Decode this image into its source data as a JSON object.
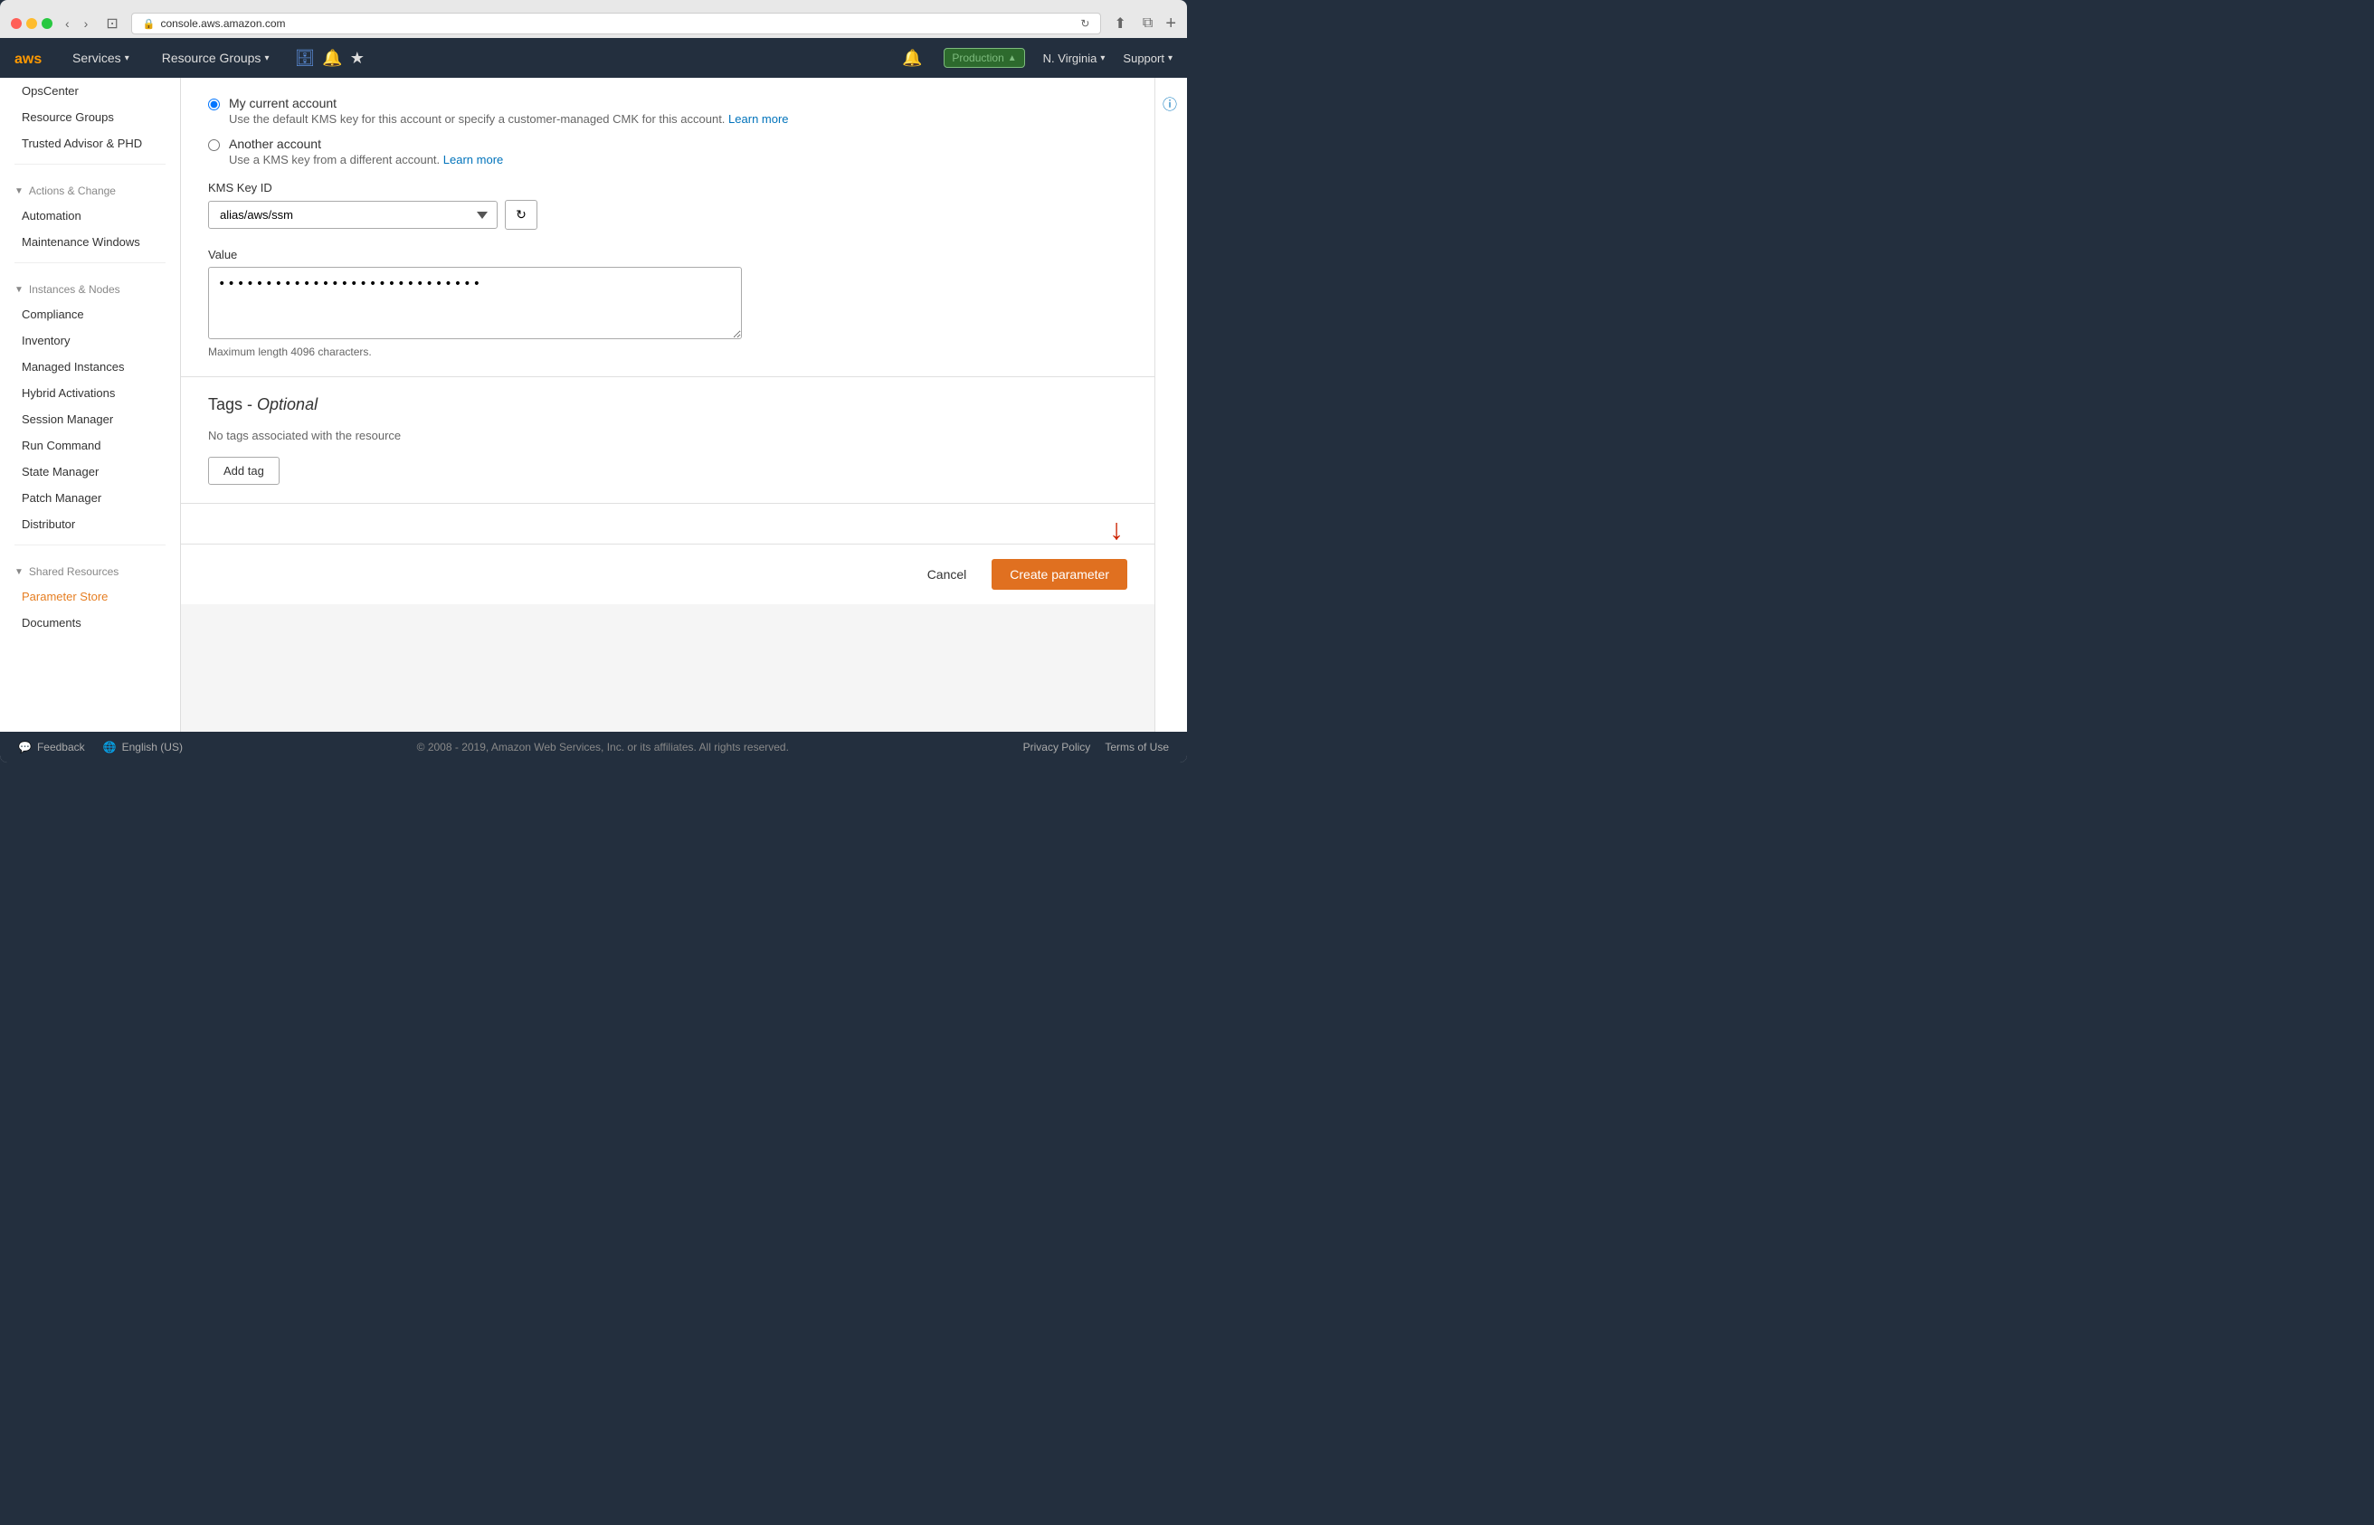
{
  "browser": {
    "url": "console.aws.amazon.com",
    "reload_icon": "↻"
  },
  "topnav": {
    "aws_logo": "aws",
    "services_label": "Services",
    "resource_groups_label": "Resource Groups",
    "bell_icon": "🔔",
    "production_label": "Production",
    "region_label": "N. Virginia",
    "support_label": "Support",
    "info_icon": "ⓘ"
  },
  "sidebar": {
    "sections": [
      {
        "label": "",
        "items": [
          {
            "name": "OpsCEnter",
            "label": "OpsCenter",
            "active": false
          },
          {
            "name": "ResourceGroups",
            "label": "Resource Groups",
            "active": false
          },
          {
            "name": "TrustedAdvisor",
            "label": "Trusted Advisor & PHD",
            "active": false
          }
        ]
      },
      {
        "label": "Actions & Change",
        "items": [
          {
            "name": "Automation",
            "label": "Automation",
            "active": false
          },
          {
            "name": "MaintenanceWindows",
            "label": "Maintenance Windows",
            "active": false
          }
        ]
      },
      {
        "label": "Instances & Nodes",
        "items": [
          {
            "name": "Compliance",
            "label": "Compliance",
            "active": false
          },
          {
            "name": "Inventory",
            "label": "Inventory",
            "active": false
          },
          {
            "name": "ManagedInstances",
            "label": "Managed Instances",
            "active": false
          },
          {
            "name": "HybridActivations",
            "label": "Hybrid Activations",
            "active": false
          },
          {
            "name": "SessionManager",
            "label": "Session Manager",
            "active": false
          },
          {
            "name": "RunCommand",
            "label": "Run Command",
            "active": false
          },
          {
            "name": "StateManager",
            "label": "State Manager",
            "active": false
          },
          {
            "name": "PatchManager",
            "label": "Patch Manager",
            "active": false
          },
          {
            "name": "Distributor",
            "label": "Distributor",
            "active": false
          }
        ]
      },
      {
        "label": "Shared Resources",
        "items": [
          {
            "name": "ParameterStore",
            "label": "Parameter Store",
            "active": true
          },
          {
            "name": "Documents",
            "label": "Documents",
            "active": false
          }
        ]
      }
    ]
  },
  "form": {
    "my_account_radio": "My current account",
    "my_account_desc": "Use the default KMS key for this account or specify a customer-managed CMK for this account.",
    "my_account_learn_more": "Learn more",
    "another_account_radio": "Another account",
    "another_account_desc": "Use a KMS key from a different account.",
    "another_account_learn_more": "Learn more",
    "kms_key_label": "KMS Key ID",
    "kms_key_value": "alias/aws/ssm",
    "value_label": "Value",
    "value_content": "••••••••••••••••••••••••••••",
    "char_limit": "Maximum length 4096 characters.",
    "tags_title": "Tags - ",
    "tags_italic": "Optional",
    "no_tags": "No tags associated with the resource",
    "add_tag_label": "Add tag",
    "cancel_label": "Cancel",
    "create_label": "Create parameter"
  },
  "footer": {
    "feedback_icon": "💬",
    "feedback_label": "Feedback",
    "globe_icon": "🌐",
    "language_label": "English (US)",
    "copyright": "© 2008 - 2019, Amazon Web Services, Inc. or its affiliates. All rights reserved.",
    "privacy_label": "Privacy Policy",
    "terms_label": "Terms of Use"
  }
}
